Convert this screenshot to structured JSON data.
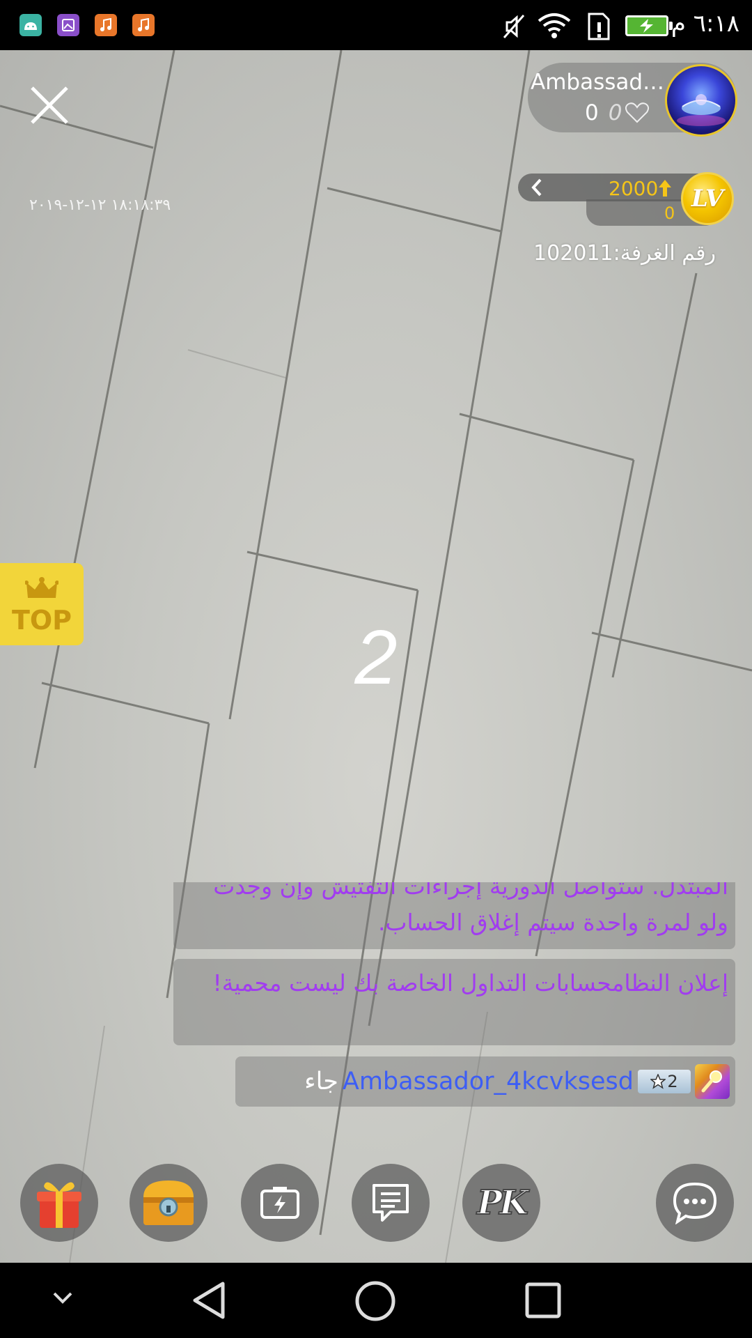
{
  "status_bar": {
    "time": "٦:١٨ م",
    "notification_icons": [
      "android-icon",
      "gallery-icon",
      "music-icon",
      "music-icon"
    ],
    "system_icons": [
      "mute-icon",
      "wifi-icon",
      "sim-alert-icon",
      "battery-charging-icon"
    ]
  },
  "stream": {
    "datetime": "١٨:١٨:٣٩ ١٢-١٢-٢٠١٩",
    "countdown": "2",
    "top_label": "TOP"
  },
  "host": {
    "name": "Ambassad…",
    "viewers": "0",
    "likes": "0"
  },
  "level": {
    "value": "2000",
    "sub_value": "0",
    "badge": "LV"
  },
  "room": {
    "label": "رقم الغرفة:102011"
  },
  "chat": {
    "message_1": "المبتذل. ستواصل الدورية إجراءات التفتيش وإن وجدت ولو لمرة واحدة سيتم إغلاق الحساب.",
    "message_2": "إعلان النظامحسابات التداول الخاصة بك ليست محمية!",
    "join": {
      "user": "Ambassador_4kcvksesd",
      "verb": "جاء",
      "level": "2"
    }
  },
  "toolbar": {
    "buttons": [
      "gift-icon",
      "treasure-chest-icon",
      "flash-camera-icon",
      "message-list-icon",
      "pk-icon",
      "chat-bubble-icon"
    ],
    "pk_label": "PK"
  },
  "colors": {
    "chat_purple": "#a13cf0",
    "username_blue": "#3d5ef5",
    "gold": "#f5c518",
    "top_yellow": "#f2d53a"
  }
}
